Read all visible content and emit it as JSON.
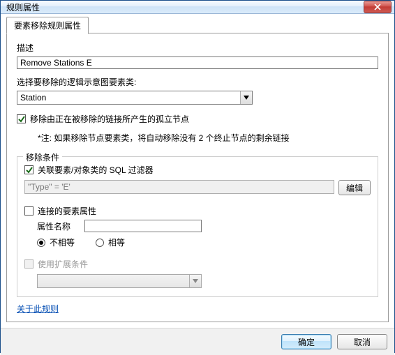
{
  "window": {
    "title": "规则属性"
  },
  "tab": {
    "label": "要素移除规则属性"
  },
  "description": {
    "label": "描述",
    "value": "Remove Stations E"
  },
  "classSelect": {
    "label": "选择要移除的逻辑示意图要素类:",
    "value": "Station"
  },
  "orphanCheckbox": {
    "label": "移除由正在被移除的链接所产生的孤立节点",
    "checked": true
  },
  "note": "*注: 如果移除节点要素类，将自动移除没有 2 个终止节点的剩余链接",
  "conditions": {
    "legend": "移除条件",
    "sqlFilter": {
      "label": "关联要素/对象类的 SQL 过滤器",
      "checked": true,
      "value": "\"Type\" = 'E'",
      "editBtn": "编辑"
    },
    "connectedAttr": {
      "label": "连接的要素属性",
      "checked": false,
      "attrNameLabel": "属性名称",
      "attrNameValue": "",
      "radioNotEqual": "不相等",
      "radioEqual": "相等",
      "radioSelected": "notEqual"
    },
    "extended": {
      "label": "使用扩展条件",
      "checked": false,
      "value": ""
    }
  },
  "link": {
    "label": "关于此规则"
  },
  "footer": {
    "ok": "确定",
    "cancel": "取消"
  }
}
